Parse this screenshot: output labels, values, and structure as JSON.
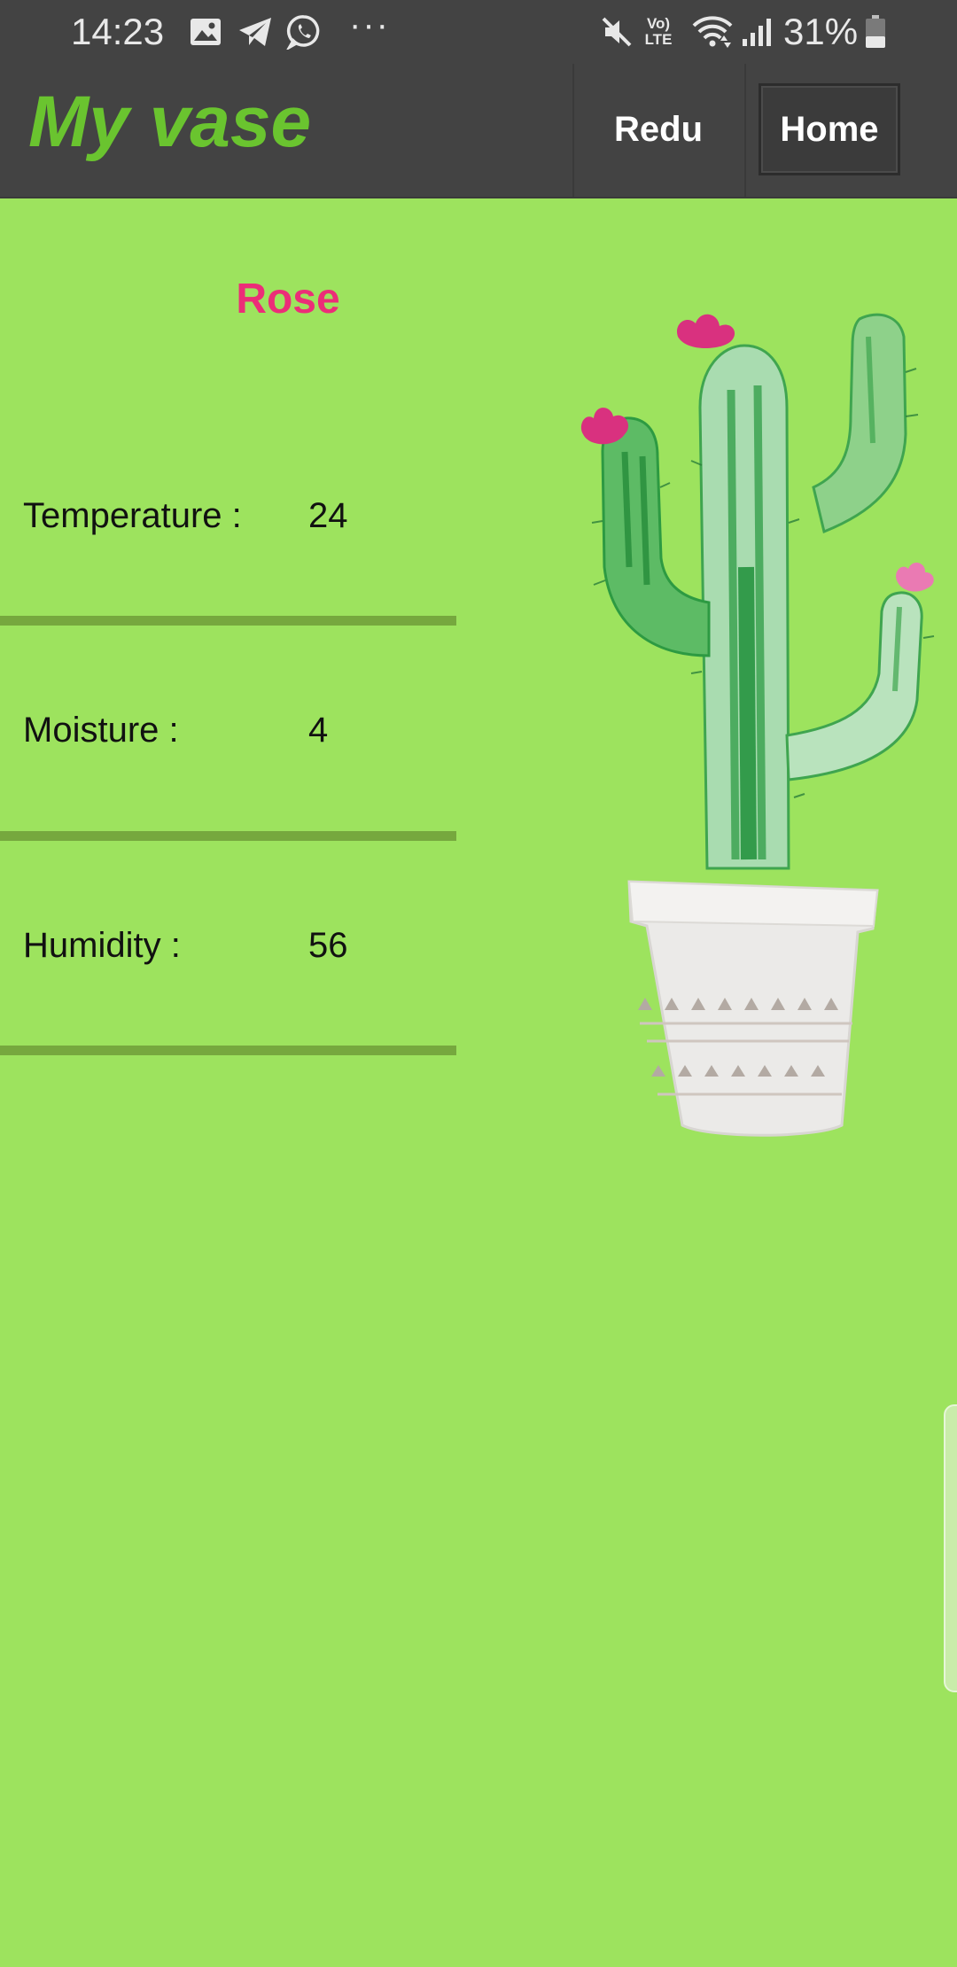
{
  "status_bar": {
    "time": "14:23",
    "more_indicator": "···",
    "battery": "31%",
    "icons": [
      "gallery-icon",
      "telegram-icon",
      "whatsapp-icon",
      "mute-icon",
      "volte-icon",
      "wifi-icon",
      "signal-icon",
      "battery-icon"
    ],
    "volte_label_top": "Vo)",
    "volte_label_bottom": "LTE"
  },
  "app_bar": {
    "title": "My vase",
    "title_color": "#6ac42f",
    "nav": [
      {
        "label": "Redu"
      },
      {
        "label": "Home"
      }
    ]
  },
  "plant": {
    "name": "Rose",
    "name_color": "#ec2d78",
    "readings": [
      {
        "label": "Temperature :",
        "value": "24"
      },
      {
        "label": "Moisture :",
        "value": "4"
      },
      {
        "label": "Humidity :",
        "value": "56"
      }
    ]
  },
  "colors": {
    "background": "#9de35e",
    "bar_background": "#434343",
    "divider": "#76a83e"
  }
}
